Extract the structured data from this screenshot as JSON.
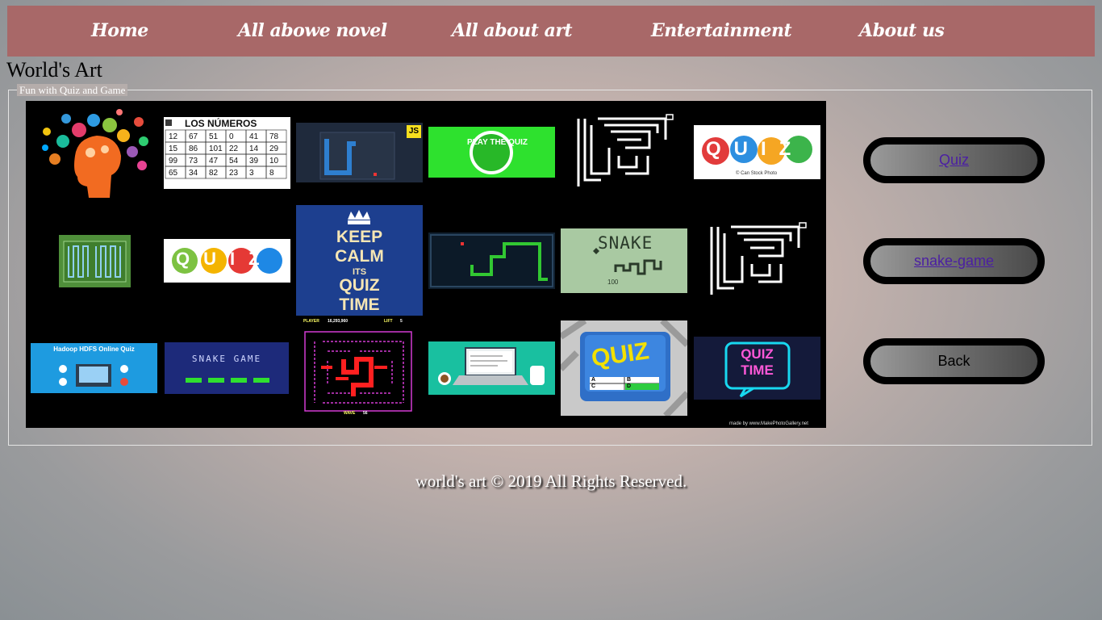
{
  "nav": {
    "items": [
      {
        "label": "Home"
      },
      {
        "label": "All abowe novel"
      },
      {
        "label": "All about art"
      },
      {
        "label": "Entertainment"
      },
      {
        "label": "About us"
      }
    ]
  },
  "page_title": "World's Art",
  "fieldset": {
    "legend": "Fun with Quiz and Game"
  },
  "collage": {
    "thumbs": [
      {
        "name": "brain-icons",
        "text": ""
      },
      {
        "name": "los-numeros",
        "text": "LOS NÚMEROS",
        "numbers": [
          "12",
          "67",
          "51",
          "0",
          "41",
          "78",
          "15",
          "86",
          "101",
          "22",
          "14",
          "29",
          "99",
          "73",
          "47",
          "54",
          "39",
          "10",
          "65",
          "34",
          "82",
          "23",
          "3",
          "8"
        ]
      },
      {
        "name": "snake-js",
        "text": "JS"
      },
      {
        "name": "play-the-quiz",
        "text": "PLAY THE QUIZ"
      },
      {
        "name": "maze-1",
        "text": ""
      },
      {
        "name": "quiz-bubbles",
        "text": "QUIZ",
        "caption": "© Can Stock Photo"
      },
      {
        "name": "green-maze",
        "text": ""
      },
      {
        "name": "quiz-colorful",
        "text": "QUIZ"
      },
      {
        "name": "keep-calm",
        "lines": [
          "KEEP",
          "CALM",
          "ITS",
          "QUIZ",
          "TIME"
        ]
      },
      {
        "name": "snake-dark",
        "text": ""
      },
      {
        "name": "snake-lcd",
        "text": "SNAKE",
        "score": "100"
      },
      {
        "name": "maze-2",
        "text": ""
      },
      {
        "name": "hadoop-quiz",
        "text": "Hadoop HDFS Online Quiz"
      },
      {
        "name": "snake-game-menu",
        "text": "SNAKE GAME"
      },
      {
        "name": "pacman-like",
        "top_left": "PLAYER",
        "top_score": "16,293,960",
        "top_lift": "LIFT",
        "top_lift_val": "5",
        "wave": "WAVE",
        "wave_val": "56"
      },
      {
        "name": "laptop-desk",
        "text": ""
      },
      {
        "name": "quiz-key",
        "text": "QUIZ",
        "keys": [
          "A",
          "B",
          "C",
          "D"
        ]
      },
      {
        "name": "quiz-time-neon",
        "lines": [
          "QUIZ",
          "TIME"
        ]
      }
    ],
    "watermark": "made by www.MakePhotoGallery.net"
  },
  "buttons": {
    "quiz": "Quiz",
    "snake": "snake-game",
    "back": "Back"
  },
  "footer": "world's art © 2019 All Rights Reserved."
}
